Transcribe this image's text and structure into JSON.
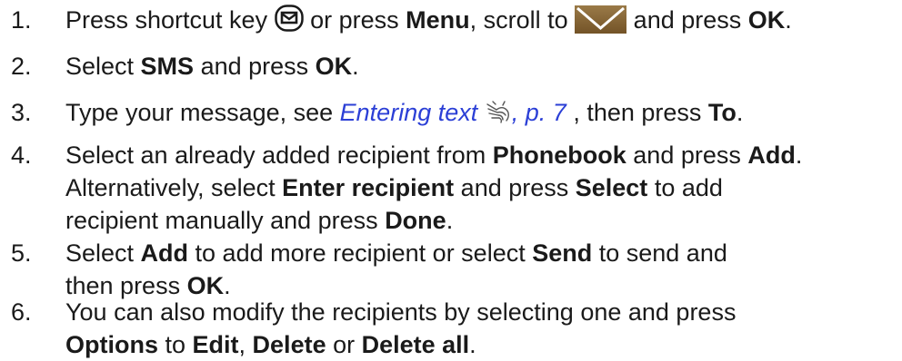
{
  "steps": [
    {
      "num": "1.",
      "t1": "Press shortcut key ",
      "t2": " or press ",
      "b1": "Menu",
      "t3": ", scroll to ",
      "t4": " and press ",
      "b2": "OK",
      "t5": ".",
      "icons": [
        "message-shortcut-key-icon",
        "envelope-icon"
      ]
    },
    {
      "num": "2.",
      "t1": "Select ",
      "b1": "SMS",
      "t2": " and press ",
      "b2": "OK",
      "t3": "."
    },
    {
      "num": "3.",
      "t1": "Type your message, see ",
      "link": "Entering text",
      "link_page": ", p. 7",
      "t2": " , then press ",
      "b1": "To",
      "t3": ".",
      "icons": [
        "hand-icon"
      ]
    },
    {
      "num": "4.",
      "line1": {
        "t1": "Select an already added recipient from ",
        "b1": "Phonebook",
        "t2": " and press ",
        "b2": "Add",
        "t3": "."
      },
      "line2": {
        "t1": "Alternatively, select ",
        "b1": "Enter recipient",
        "t2": " and press ",
        "b2": "Select",
        "t3": " to add"
      },
      "line3": {
        "t1": "recipient manually and press ",
        "b1": "Done",
        "t2": "."
      }
    },
    {
      "num": "5.",
      "line1": {
        "t1": "Select ",
        "b1": "Add",
        "t2": " to add more recipient or select ",
        "b2": "Send",
        "t3": " to send and"
      },
      "line2": {
        "t1": "then press ",
        "b1": "OK",
        "t2": "."
      }
    },
    {
      "num": "6.",
      "line1": {
        "t1": "You can also modify the recipients by selecting one and press"
      },
      "line2": {
        "b1": "Options",
        "t1": " to ",
        "b2": "Edit",
        "t2": ", ",
        "b3": "Delete",
        "t3": " or ",
        "b4": "Delete all",
        "t4": "."
      }
    }
  ],
  "colors": {
    "text": "#1a1a1a",
    "link": "#2b3fd6",
    "envelope_bg": "#8a6a3a",
    "envelope_stroke": "#ffffff"
  }
}
